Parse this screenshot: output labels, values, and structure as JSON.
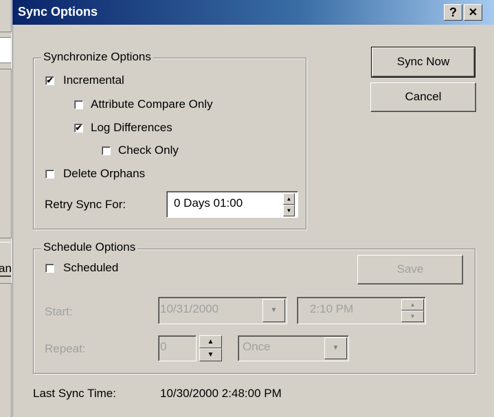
{
  "background_window": {
    "partial_button_label": "an"
  },
  "dialog": {
    "title": "Sync Options",
    "help_button": "?",
    "close_button": "✕"
  },
  "sync_group": {
    "legend": "Synchronize Options",
    "incremental": {
      "label": "Incremental",
      "checked": true
    },
    "attribute_compare": {
      "label": "Attribute Compare Only",
      "checked": false
    },
    "log_differences": {
      "label": "Log Differences",
      "checked": true
    },
    "check_only": {
      "label": "Check Only",
      "checked": false
    },
    "delete_orphans": {
      "label": "Delete Orphans",
      "checked": false
    },
    "retry_label": "Retry Sync For:",
    "retry_value": "0  Days 01:00"
  },
  "buttons": {
    "sync_now": "Sync Now",
    "cancel": "Cancel",
    "save": "Save"
  },
  "schedule_group": {
    "legend": "Schedule Options",
    "scheduled": {
      "label": "Scheduled",
      "checked": false
    },
    "start_label": "Start:",
    "start_date": "10/31/2000",
    "start_time": "2:10 PM",
    "repeat_label": "Repeat:",
    "repeat_count": "0",
    "repeat_interval": "Once"
  },
  "last_sync": {
    "label": "Last Sync Time:",
    "value": "10/30/2000 2:48:00 PM"
  }
}
